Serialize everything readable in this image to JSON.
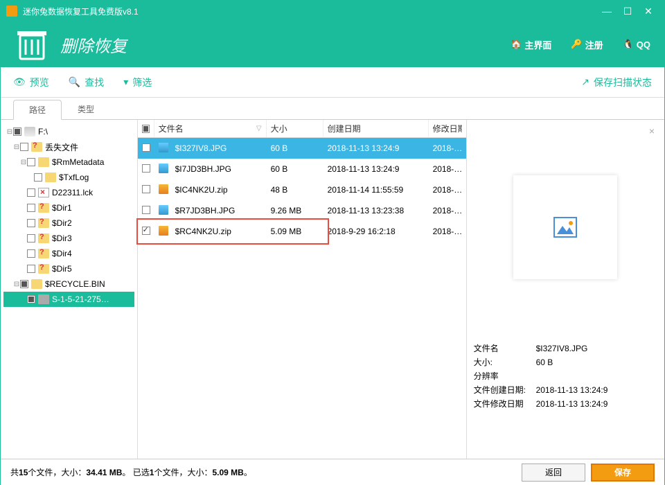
{
  "window": {
    "title": "迷你兔数据恢复工具免费版v8.1"
  },
  "header": {
    "page_title": "删除恢复",
    "links": {
      "home": "主界面",
      "register": "注册",
      "qq": "QQ"
    }
  },
  "toolbar": {
    "preview": "预览",
    "find": "查找",
    "filter": "筛选",
    "save_scan": "保存扫描状态"
  },
  "tabs": {
    "path": "路径",
    "type": "类型"
  },
  "tree": [
    {
      "indent": 0,
      "toggle": "⊟",
      "cbstate": "filled",
      "icon": "ico-drive",
      "label": "F:\\"
    },
    {
      "indent": 1,
      "toggle": "⊟",
      "cbstate": "",
      "icon": "ico-folder-q",
      "label": "丢失文件"
    },
    {
      "indent": 2,
      "toggle": "⊟",
      "cbstate": "",
      "icon": "ico-folder",
      "label": "$RmMetadata"
    },
    {
      "indent": 3,
      "toggle": "",
      "cbstate": "",
      "icon": "ico-folder",
      "label": "$TxfLog"
    },
    {
      "indent": 2,
      "toggle": "",
      "cbstate": "",
      "icon": "ico-lock",
      "label": "D22311.lck"
    },
    {
      "indent": 2,
      "toggle": "",
      "cbstate": "",
      "icon": "ico-folder-q",
      "label": "$Dir1"
    },
    {
      "indent": 2,
      "toggle": "",
      "cbstate": "",
      "icon": "ico-folder-q",
      "label": "$Dir2"
    },
    {
      "indent": 2,
      "toggle": "",
      "cbstate": "",
      "icon": "ico-folder-q",
      "label": "$Dir3"
    },
    {
      "indent": 2,
      "toggle": "",
      "cbstate": "",
      "icon": "ico-folder-q",
      "label": "$Dir4"
    },
    {
      "indent": 2,
      "toggle": "",
      "cbstate": "",
      "icon": "ico-folder-q",
      "label": "$Dir5"
    },
    {
      "indent": 1,
      "toggle": "⊟",
      "cbstate": "filled",
      "icon": "ico-folder",
      "label": "$RECYCLE.BIN"
    },
    {
      "indent": 2,
      "toggle": "",
      "cbstate": "filled",
      "icon": "ico-gray",
      "label": "S-1-5-21-275…",
      "selected": true
    }
  ],
  "grid": {
    "headers": {
      "name": "文件名",
      "size": "大小",
      "cdate": "创建日期",
      "mdate": "修改日期"
    },
    "rows": [
      {
        "cb": "",
        "icon": "fi-jpg",
        "name": "$I327IV8.JPG",
        "size": "60 B",
        "cdate": "2018-11-13 13:24:9",
        "mdate": "2018-…",
        "selected": true
      },
      {
        "cb": "",
        "icon": "fi-jpg",
        "name": "$I7JD3BH.JPG",
        "size": "60 B",
        "cdate": "2018-11-13 13:24:9",
        "mdate": "2018-…"
      },
      {
        "cb": "",
        "icon": "fi-zip",
        "name": "$IC4NK2U.zip",
        "size": "48 B",
        "cdate": "2018-11-14 11:55:59",
        "mdate": "2018-…"
      },
      {
        "cb": "",
        "icon": "fi-jpg",
        "name": "$R7JD3BH.JPG",
        "size": "9.26 MB",
        "cdate": "2018-11-13 13:23:38",
        "mdate": "2018-…"
      },
      {
        "cb": "checked",
        "icon": "fi-zip",
        "name": "$RC4NK2U.zip",
        "size": "5.09 MB",
        "cdate": "2018-9-29 16:2:18",
        "mdate": "2018-…",
        "highlight": true
      }
    ]
  },
  "preview": {
    "labels": {
      "filename": "文件名",
      "size": "大小:",
      "resolution": "分辨率",
      "cdate": "文件创建日期:",
      "mdate": "文件修改日期"
    },
    "values": {
      "filename": "$I327IV8.JPG",
      "size": "60 B",
      "resolution": "",
      "cdate": "2018-11-13 13:24:9",
      "mdate": "2018-11-13 13:24:9"
    }
  },
  "status": {
    "total_prefix": "共",
    "total_count": "15",
    "total_mid": "个文件，大小：",
    "total_size": "34.41 MB",
    "sel_prefix": "。  已选",
    "sel_count": "1",
    "sel_mid": "个文件，大小：",
    "sel_size": "5.09 MB",
    "suffix": "。",
    "back": "返回",
    "save": "保存"
  }
}
